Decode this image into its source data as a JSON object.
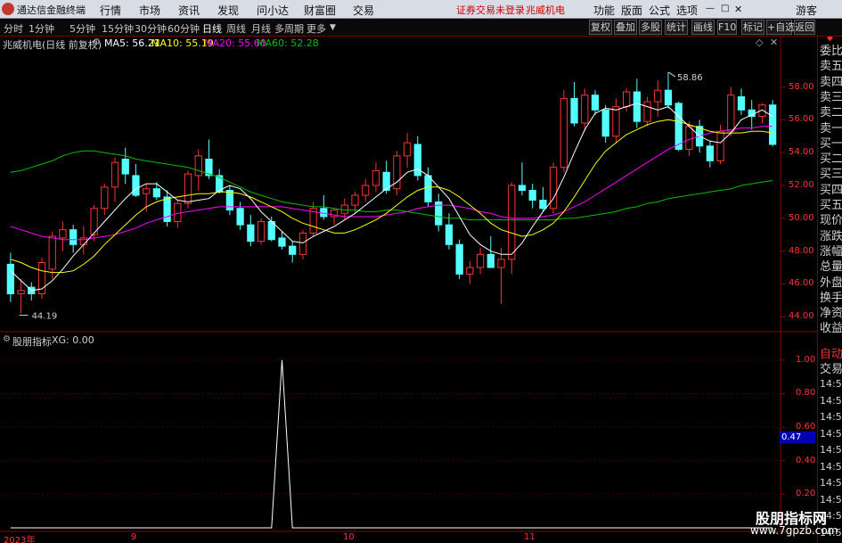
{
  "menubar": {
    "app_name": "通达信金融终端",
    "items": [
      "行情",
      "市场",
      "资讯",
      "发现",
      "问小达",
      "财富圈",
      "交易"
    ],
    "notice": "证券交易未登录",
    "stock": "兆威机电",
    "right_items": [
      "功能",
      "版面",
      "公式",
      "选项"
    ],
    "guest": "游客"
  },
  "toolbar": {
    "periods": [
      "分时",
      "1分钟",
      "5分钟",
      "15分钟",
      "30分钟",
      "60分钟",
      "日线",
      "周线",
      "月线",
      "多周期",
      "更多"
    ],
    "active": "日线",
    "right_buttons": [
      "复权",
      "叠加",
      "多股",
      "统计",
      "画线",
      "F10",
      "标记",
      "+自选",
      "返回"
    ]
  },
  "infobar": {
    "title": "兆威机电(日线 前复权)",
    "ma5": "MA5: 56.21",
    "ma10": "MA10: 55.19",
    "ma20": "MA20: 55.60",
    "ma60": "MA60: 52.28"
  },
  "colors": {
    "up": "#ff3232",
    "down": "#54ffff",
    "ma5": "#ffffff",
    "ma10": "#ffff00",
    "ma20": "#ff00ff",
    "ma60": "#00c000"
  },
  "lower": {
    "title": "股朋指标",
    "value": "XG: 0.00",
    "current": "0.47"
  },
  "right_panel": {
    "top_icon": "◆",
    "items": [
      "委比",
      "卖五",
      "卖四",
      "卖三",
      "卖二",
      "卖一",
      "买一",
      "买二",
      "买三",
      "买四",
      "买五",
      "现价",
      "涨跌",
      "涨幅",
      "总量",
      "外盘",
      "换手",
      "净资",
      "收益"
    ],
    "auto_labels": [
      "自动",
      "交易"
    ],
    "times": [
      "14:56",
      "14:56",
      "14:56",
      "14:56",
      "14:56",
      "14:56",
      "14:56",
      "14:56",
      "14:56",
      "14:56"
    ]
  },
  "watermark": {
    "line1": "股朋指标网",
    "line2": "www.7gpzb.com"
  },
  "chart_data": [
    {
      "type": "candlestick",
      "title": "兆威机电(日线 前复权)",
      "ylim": [
        43.2,
        60.2
      ],
      "y_ticks": [
        "58.00",
        "56.00",
        "54.00",
        "52.00",
        "50.00",
        "48.00",
        "46.00",
        "44.00"
      ],
      "x_ticks": [
        "2023年",
        "9",
        "10",
        "11"
      ],
      "annotations": [
        "58.86",
        "44.19"
      ],
      "ohlc": [
        [
          47.2,
          47.9,
          44.9,
          45.4
        ],
        [
          45.4,
          46.3,
          44.2,
          45.6
        ],
        [
          45.8,
          46.1,
          45.0,
          45.4
        ],
        [
          45.4,
          47.6,
          45.1,
          47.3
        ],
        [
          46.9,
          49.2,
          46.3,
          48.9
        ],
        [
          48.8,
          49.8,
          48.0,
          49.3
        ],
        [
          49.3,
          49.6,
          47.9,
          48.4
        ],
        [
          48.4,
          49.5,
          47.8,
          48.8
        ],
        [
          49.0,
          50.8,
          48.6,
          50.6
        ],
        [
          50.6,
          52.1,
          50.2,
          51.9
        ],
        [
          51.9,
          53.7,
          51.0,
          53.4
        ],
        [
          53.6,
          54.3,
          52.1,
          52.7
        ],
        [
          52.6,
          53.3,
          51.3,
          51.4
        ],
        [
          51.5,
          52.1,
          50.4,
          51.8
        ],
        [
          51.8,
          52.2,
          51.1,
          51.3
        ],
        [
          51.3,
          51.7,
          49.5,
          49.8
        ],
        [
          49.8,
          51.1,
          49.4,
          50.9
        ],
        [
          50.9,
          52.9,
          50.6,
          52.7
        ],
        [
          52.6,
          54.2,
          51.7,
          53.8
        ],
        [
          53.6,
          54.8,
          52.4,
          52.6
        ],
        [
          52.6,
          53.0,
          51.5,
          51.6
        ],
        [
          51.7,
          52.0,
          50.2,
          50.5
        ],
        [
          50.6,
          51.0,
          49.3,
          49.6
        ],
        [
          49.6,
          50.2,
          48.3,
          48.6
        ],
        [
          48.6,
          50.0,
          48.4,
          49.8
        ],
        [
          49.8,
          50.1,
          48.6,
          48.7
        ],
        [
          48.8,
          49.2,
          48.1,
          48.3
        ],
        [
          48.3,
          48.6,
          47.3,
          47.8
        ],
        [
          47.8,
          49.3,
          47.5,
          49.1
        ],
        [
          49.1,
          51.0,
          48.9,
          50.6
        ],
        [
          50.6,
          51.4,
          49.9,
          50.1
        ],
        [
          50.1,
          50.6,
          49.6,
          50.5
        ],
        [
          50.3,
          51.2,
          49.9,
          50.8
        ],
        [
          50.8,
          51.6,
          50.3,
          51.4
        ],
        [
          51.4,
          52.4,
          51.0,
          52.0
        ],
        [
          52.0,
          53.4,
          51.6,
          52.9
        ],
        [
          52.8,
          53.5,
          51.5,
          51.7
        ],
        [
          51.8,
          54.1,
          51.4,
          53.8
        ],
        [
          53.8,
          55.2,
          53.1,
          54.6
        ],
        [
          54.5,
          55.0,
          52.3,
          52.6
        ],
        [
          52.6,
          53.1,
          50.7,
          51.0
        ],
        [
          51.0,
          51.5,
          49.2,
          49.6
        ],
        [
          49.6,
          50.3,
          48.1,
          48.4
        ],
        [
          48.4,
          48.7,
          46.3,
          46.6
        ],
        [
          46.6,
          47.4,
          46.0,
          47.0
        ],
        [
          47.0,
          48.2,
          46.6,
          47.8
        ],
        [
          47.8,
          48.9,
          47.2,
          47.0
        ],
        [
          47.0,
          48.2,
          44.8,
          47.5
        ],
        [
          47.5,
          52.2,
          46.6,
          52.0
        ],
        [
          52.0,
          53.4,
          51.4,
          51.7
        ],
        [
          51.7,
          52.1,
          50.6,
          51.1
        ],
        [
          51.1,
          51.9,
          50.4,
          50.6
        ],
        [
          50.6,
          53.4,
          50.3,
          53.1
        ],
        [
          53.1,
          57.8,
          52.8,
          57.3
        ],
        [
          57.3,
          58.3,
          55.6,
          55.8
        ],
        [
          55.8,
          57.9,
          55.3,
          57.5
        ],
        [
          57.5,
          57.8,
          56.3,
          56.6
        ],
        [
          56.6,
          56.9,
          54.6,
          55.0
        ],
        [
          55.0,
          57.3,
          54.6,
          56.8
        ],
        [
          56.8,
          57.9,
          56.5,
          57.7
        ],
        [
          57.7,
          58.5,
          55.5,
          55.9
        ],
        [
          55.9,
          57.4,
          55.6,
          57.1
        ],
        [
          57.1,
          58.4,
          56.2,
          57.8
        ],
        [
          57.8,
          58.9,
          56.7,
          56.9
        ],
        [
          57.0,
          57.1,
          54.1,
          54.2
        ],
        [
          54.2,
          55.9,
          53.8,
          55.6
        ],
        [
          55.6,
          56.0,
          54.0,
          54.4
        ],
        [
          54.4,
          54.7,
          53.1,
          53.5
        ],
        [
          53.5,
          55.7,
          53.3,
          55.3
        ],
        [
          55.3,
          58.0,
          55.0,
          57.5
        ],
        [
          57.4,
          57.9,
          56.3,
          56.6
        ],
        [
          56.6,
          57.2,
          55.4,
          56.2
        ],
        [
          56.2,
          57.0,
          55.8,
          56.9
        ],
        [
          56.9,
          57.2,
          54.4,
          54.5
        ]
      ],
      "ma5": [
        46.8,
        46.2,
        45.6,
        45.7,
        46.2,
        46.9,
        47.7,
        48.4,
        49.1,
        49.8,
        50.5,
        51.2,
        51.8,
        52.1,
        52.1,
        51.6,
        51.1,
        51.0,
        51.1,
        51.2,
        51.7,
        52.0,
        51.8,
        51.2,
        50.4,
        49.8,
        49.2,
        48.6,
        48.5,
        48.9,
        49.2,
        49.5,
        49.9,
        50.3,
        50.8,
        51.3,
        51.8,
        52.2,
        52.8,
        53.0,
        52.6,
        51.9,
        51.2,
        50.1,
        49.0,
        48.4,
        48.0,
        47.8,
        47.8,
        48.5,
        49.5,
        50.4,
        51.2,
        52.5,
        54.0,
        55.4,
        56.4,
        56.7,
        56.6,
        56.8,
        57.0,
        56.8,
        56.6,
        56.8,
        56.2,
        55.6,
        55.0,
        54.7,
        54.6,
        55.2,
        56.0,
        56.3,
        56.6,
        56.2
      ],
      "ma10": [
        47.5,
        47.3,
        47.0,
        46.8,
        46.7,
        46.7,
        46.8,
        47.2,
        47.7,
        48.4,
        49.0,
        49.6,
        50.2,
        50.7,
        51.0,
        51.2,
        51.3,
        51.4,
        51.5,
        51.5,
        51.6,
        51.6,
        51.5,
        51.3,
        51.0,
        50.7,
        50.4,
        50.0,
        49.7,
        49.5,
        49.3,
        49.1,
        49.1,
        49.3,
        49.6,
        49.9,
        50.3,
        50.8,
        51.3,
        51.7,
        51.9,
        51.9,
        51.7,
        51.3,
        50.8,
        50.3,
        49.7,
        49.3,
        49.1,
        48.9,
        49.0,
        49.3,
        49.7,
        50.4,
        51.3,
        52.3,
        53.3,
        54.1,
        54.6,
        55.1,
        55.4,
        55.7,
        55.9,
        56.0,
        55.9,
        55.7,
        55.5,
        55.3,
        55.2,
        55.2,
        55.2,
        55.3,
        55.3,
        55.2
      ],
      "ma20": [
        49.5,
        49.3,
        49.1,
        48.9,
        48.8,
        48.7,
        48.7,
        48.7,
        48.8,
        48.9,
        49.0,
        49.2,
        49.4,
        49.7,
        49.9,
        50.1,
        50.3,
        50.4,
        50.5,
        50.6,
        50.7,
        50.7,
        50.7,
        50.7,
        50.7,
        50.7,
        50.7,
        50.6,
        50.5,
        50.4,
        50.3,
        50.2,
        50.1,
        50.1,
        50.1,
        50.1,
        50.2,
        50.3,
        50.4,
        50.6,
        50.7,
        50.8,
        50.8,
        50.7,
        50.6,
        50.4,
        50.3,
        50.1,
        50.0,
        50.0,
        50.0,
        50.1,
        50.2,
        50.4,
        50.7,
        51.0,
        51.4,
        51.8,
        52.2,
        52.6,
        53.0,
        53.4,
        53.8,
        54.2,
        54.5,
        54.8,
        55.0,
        55.2,
        55.3,
        55.4,
        55.5,
        55.5,
        55.6,
        55.6
      ],
      "ma60": [
        52.8,
        52.9,
        53.1,
        53.3,
        53.5,
        53.8,
        54.0,
        54.1,
        54.1,
        54.0,
        53.9,
        53.8,
        53.6,
        53.5,
        53.4,
        53.3,
        53.2,
        53.1,
        52.9,
        52.7,
        52.5,
        52.2,
        51.9,
        51.6,
        51.4,
        51.2,
        51.0,
        50.9,
        50.8,
        50.7,
        50.7,
        50.6,
        50.5,
        50.5,
        50.4,
        50.4,
        50.5,
        50.5,
        50.4,
        50.3,
        50.2,
        50.1,
        50.0,
        50.0,
        49.9,
        49.9,
        49.9,
        49.9,
        49.9,
        49.9,
        49.9,
        49.9,
        49.9,
        50.0,
        50.0,
        50.1,
        50.2,
        50.3,
        50.4,
        50.6,
        50.7,
        50.9,
        51.0,
        51.2,
        51.3,
        51.4,
        51.5,
        51.6,
        51.7,
        51.8,
        52.0,
        52.1,
        52.2,
        52.3
      ]
    },
    {
      "type": "line",
      "title": "股朋指标",
      "ylim": [
        0,
        1.1
      ],
      "y_ticks": [
        "1.00",
        "0.80",
        "0.60",
        "0.40",
        "0.20"
      ],
      "series": [
        {
          "name": "XG",
          "spike_index": 26,
          "values_note": ""
        }
      ],
      "values": [
        0,
        0,
        0,
        0,
        0,
        0,
        0,
        0,
        0,
        0,
        0,
        0,
        0,
        0,
        0,
        0,
        0,
        0,
        0,
        0,
        0,
        0,
        0,
        0,
        0,
        0,
        1,
        0,
        0,
        0,
        0,
        0,
        0,
        0,
        0,
        0,
        0,
        0,
        0,
        0,
        0,
        0,
        0,
        0,
        0,
        0,
        0,
        0,
        0,
        0,
        0,
        0,
        0,
        0,
        0,
        0,
        0,
        0,
        0,
        0,
        0,
        0,
        0,
        0,
        0,
        0,
        0,
        0,
        0,
        0,
        0,
        0,
        0,
        0
      ]
    }
  ]
}
